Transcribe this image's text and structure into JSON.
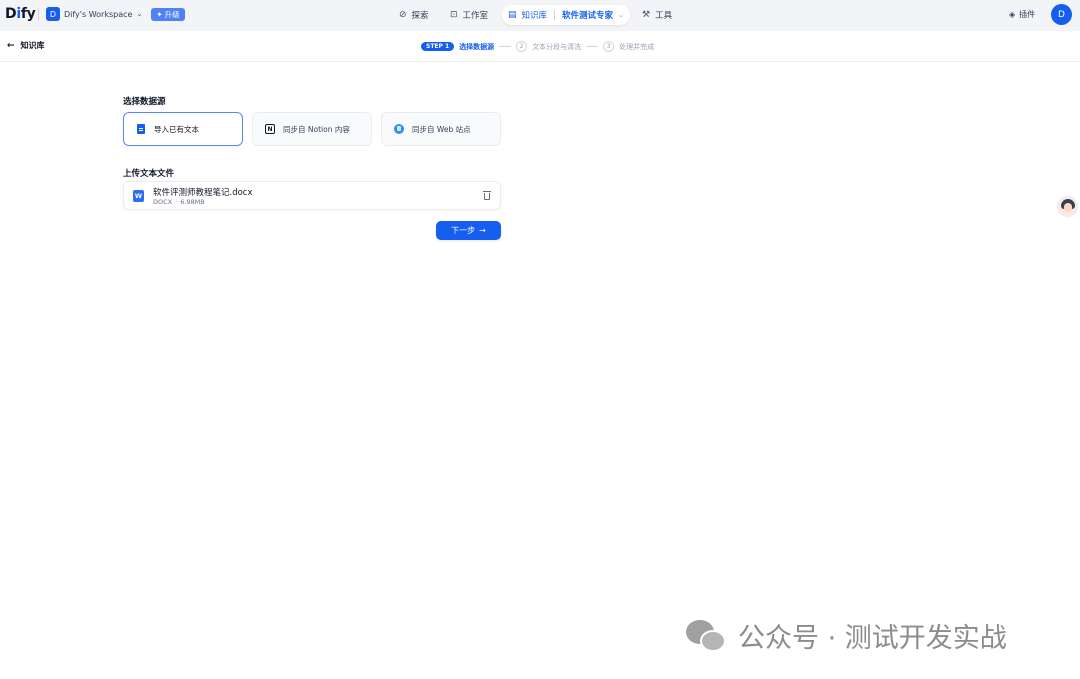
{
  "topbar": {
    "logo": {
      "pre": "D",
      "accent": "i",
      "post": "fy"
    },
    "workspace": {
      "initial": "D",
      "name": "Dify's Workspace",
      "upgrade_label": "升级"
    },
    "nav": {
      "explore": "探索",
      "studio": "工作室",
      "knowledge": "知识库",
      "current_dataset": "软件测试专家",
      "tools": "工具"
    },
    "plugins": "插件",
    "avatar_initial": "D"
  },
  "subheader": {
    "back_label": "知识库",
    "steps": [
      {
        "badge": "STEP 1",
        "label": "选择数据源",
        "state": "active"
      },
      {
        "badge": "2",
        "label": "文本分段与清洗",
        "state": "inactive"
      },
      {
        "badge": "3",
        "label": "处理并完成",
        "state": "inactive"
      }
    ]
  },
  "datasource": {
    "title": "选择数据源",
    "options": [
      {
        "label": "导入已有文本",
        "icon": "file-text-icon",
        "selected": true
      },
      {
        "label": "同步自 Notion 内容",
        "icon": "notion-icon",
        "selected": false
      },
      {
        "label": "同步自 Web 站点",
        "icon": "web-icon",
        "selected": false
      }
    ]
  },
  "upload": {
    "title": "上传文本文件",
    "file": {
      "name": "软件评测师教程笔记.docx",
      "type": "DOCX",
      "separator": "·",
      "size": "6.98MB",
      "icon_letter": "W"
    }
  },
  "next_button": {
    "label": "下一步",
    "arrow": "→"
  },
  "watermark": {
    "text": "公众号 · 测试开发实战"
  },
  "colors": {
    "primary": "#155eef",
    "topbar_bg": "#f2f4f7",
    "upgrade": "#4e82f5"
  }
}
